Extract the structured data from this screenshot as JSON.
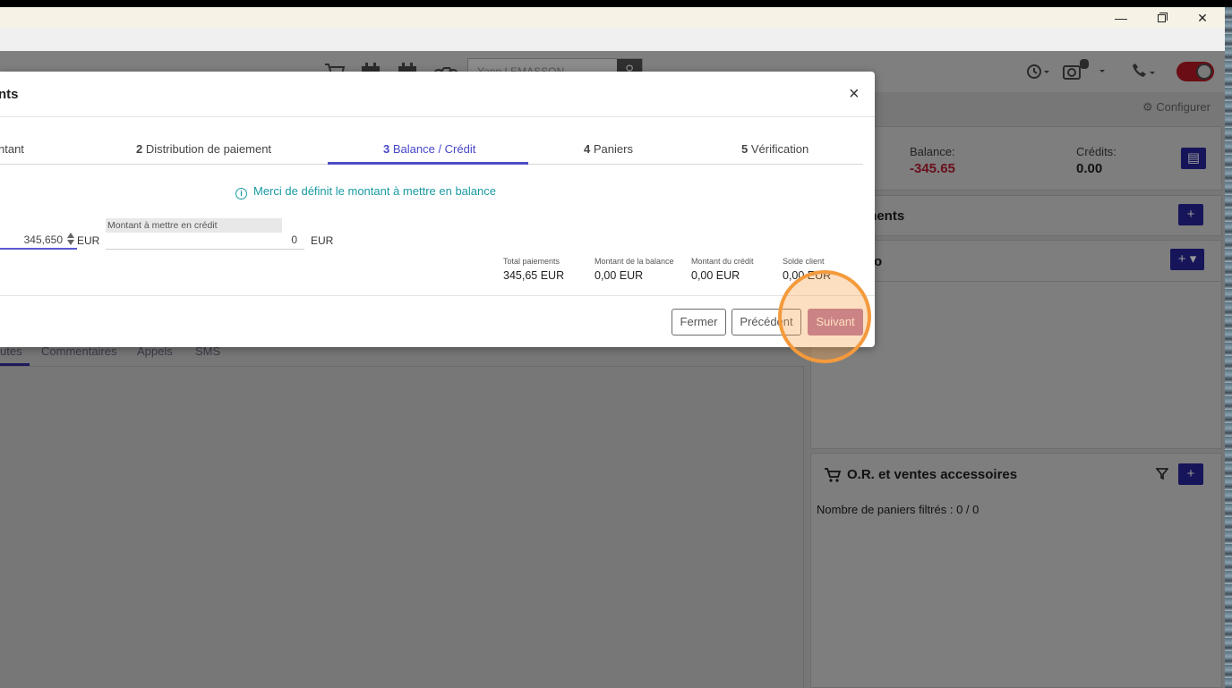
{
  "window": {
    "min_glyph": "—",
    "close_glyph": "✕"
  },
  "header": {
    "search_value": "Yann LEMASSON",
    "search_icon_glyph": "⚲"
  },
  "page": {
    "configurer_label": "Configurer",
    "balance_label": "Balance:",
    "balance_value": "-345.65",
    "credits_label": "Crédits:",
    "credits_value": "0.00",
    "section_paiements": "ments",
    "section_info": "o",
    "plus_glyph": "+",
    "plus_dropdown_glyph": "+ ▾",
    "section_paniers": "O.R. et ventes accessoires",
    "paniers_note": "Nombre de paniers filtrés : 0 / 0",
    "tabs": [
      "utes",
      "Commentaires",
      "Appels",
      "SMS"
    ],
    "colors": {
      "negative": "#c0243a",
      "primary": "#2d2aa8"
    }
  },
  "modal": {
    "title": "nts",
    "close_glyph": "×",
    "steps": [
      {
        "num": "",
        "label": "ntant"
      },
      {
        "num": "2",
        "label": "Distribution de paiement"
      },
      {
        "num": "3",
        "label": "Balance / Crédit"
      },
      {
        "num": "4",
        "label": "Paniers"
      },
      {
        "num": "5",
        "label": "Vérification"
      }
    ],
    "active_step": 3,
    "info_icon_glyph": "i",
    "info_message": "Merci de définit le montant à mettre en balance",
    "balance_amount_value": "345,650",
    "currency": "EUR",
    "credit_label": "Montant à mettre en crédit",
    "credit_amount_value": "0",
    "summary": [
      {
        "label": "Total paiements",
        "value": "345,65 EUR"
      },
      {
        "label": "Montant de la balance",
        "value": "0,00 EUR"
      },
      {
        "label": "Montant du crédit",
        "value": "0,00 EUR"
      },
      {
        "label": "Solde client",
        "value": "0,00 EUR"
      }
    ],
    "buttons": {
      "close": "Fermer",
      "previous": "Précédent",
      "next": "Suivant"
    },
    "colors": {
      "accent": "#4e4ec4",
      "info": "#1a9aa3",
      "next": "#b774a6"
    }
  },
  "highlight": {
    "color": "#f49a3c"
  }
}
